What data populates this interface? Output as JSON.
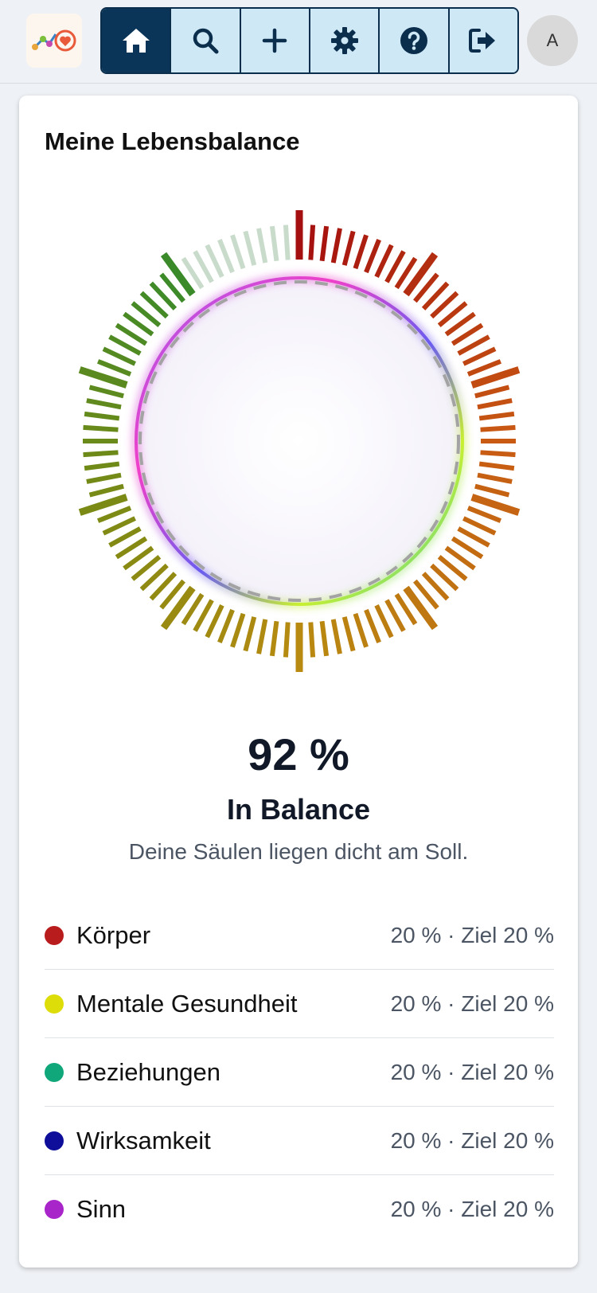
{
  "header": {
    "logo": "app-logo",
    "nav": [
      {
        "icon": "home-icon",
        "active": true
      },
      {
        "icon": "search-icon",
        "active": false
      },
      {
        "icon": "plus-icon",
        "active": false
      },
      {
        "icon": "gear-icon",
        "active": false
      },
      {
        "icon": "help-icon",
        "active": false
      },
      {
        "icon": "logout-icon",
        "active": false
      }
    ],
    "avatar_letter": "A"
  },
  "card": {
    "title": "Meine Lebensbalance",
    "score": "92 %",
    "status": "In Balance",
    "subtitle": "Deine Säulen liegen dicht am Soll."
  },
  "pillars": [
    {
      "name": "Körper",
      "value": "20 % · Ziel 20 %",
      "color": "#b91c1c"
    },
    {
      "name": "Mentale Gesundheit",
      "value": "20 % · Ziel 20 %",
      "color": "#dddd0a"
    },
    {
      "name": "Beziehungen",
      "value": "20 % · Ziel 20 %",
      "color": "#10a87a"
    },
    {
      "name": "Wirksamkeit",
      "value": "20 % · Ziel 20 %",
      "color": "#0e0e9a"
    },
    {
      "name": "Sinn",
      "value": "20 % · Ziel 20 %",
      "color": "#a826c9"
    }
  ],
  "colors": {
    "nav_active": "#0b3558",
    "nav_inactive": "#cfe8f6",
    "ring_start": "#a50f0f",
    "ring_end": "#3a8a2a"
  }
}
